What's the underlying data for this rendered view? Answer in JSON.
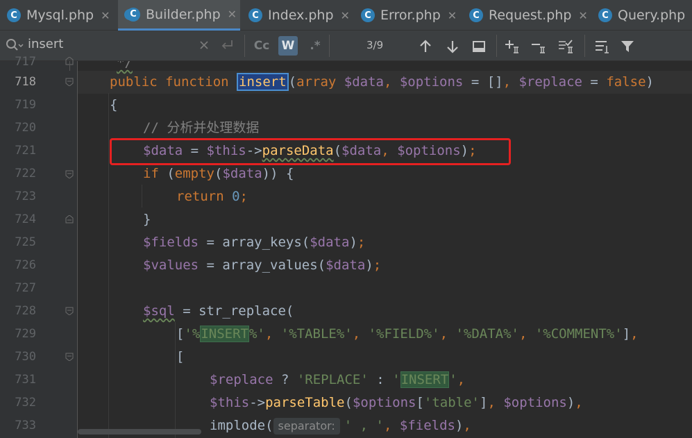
{
  "tabs": [
    {
      "label": "Mysql.php",
      "active": false
    },
    {
      "label": "Builder.php",
      "active": true
    },
    {
      "label": "Index.php",
      "active": false
    },
    {
      "label": "Error.php",
      "active": false
    },
    {
      "label": "Request.php",
      "active": false
    },
    {
      "label": "Query.php",
      "active": false
    }
  ],
  "search": {
    "query": "insert",
    "match_count": "3/9",
    "match_case_label": "Cc",
    "words_label": "W",
    "regex_label": ".*"
  },
  "editor": {
    "line_numbers": [
      "717",
      "718",
      "719",
      "720",
      "721",
      "722",
      "723",
      "724",
      "725",
      "726",
      "727",
      "728",
      "729",
      "730",
      "731",
      "732",
      "733"
    ],
    "current_line": "718",
    "comment_720": "// 分析并处理数据",
    "param_hint": "separator:"
  },
  "colors": {
    "keyword": "#cc7832",
    "variable": "#9876aa",
    "function": "#ffc66d",
    "string": "#6a8759",
    "number": "#6897bb",
    "comment": "#808080",
    "highlight_box": "#e52121"
  }
}
